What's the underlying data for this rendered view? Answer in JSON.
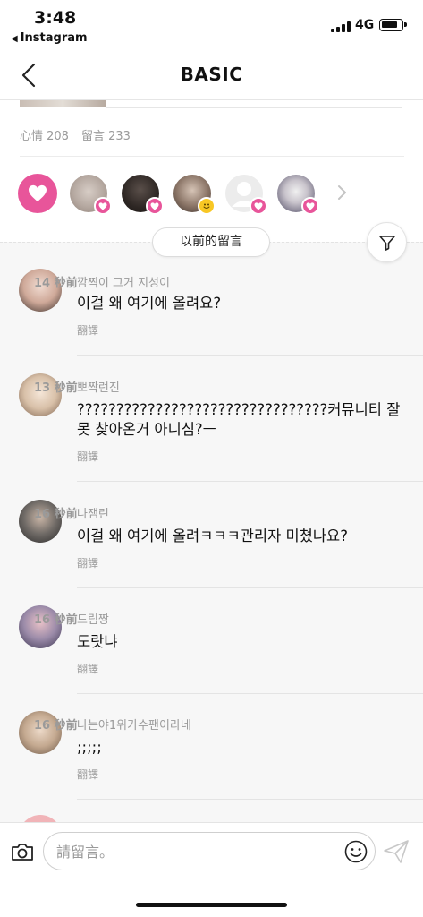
{
  "status_bar": {
    "time": "3:48",
    "back_app": "Instagram",
    "network": "4G"
  },
  "header": {
    "title": "BASIC"
  },
  "stats": {
    "likes": "心情 208",
    "comments": "留言 233"
  },
  "load_more": "以前的留言",
  "comments": [
    {
      "name": "깜찍이 그거 지성이",
      "time": "14 秒前",
      "text": "이걸 왜 여기에 올려요?",
      "translate": "翻譯",
      "avatar_color": "#d9cfcc"
    },
    {
      "name": "뽀짝런진",
      "time": "13 秒前",
      "text": "????????????????????????????????커뮤니티 잘 못 찾아온거 아니심?ㅡ",
      "translate": "翻譯",
      "avatar_color": "#e8d9c9"
    },
    {
      "name": "나잼린",
      "time": "16 秒前",
      "text": "이걸 왜 여기에 올려ㅋㅋㅋ관리자 미쳤나요?",
      "translate": "翻譯",
      "avatar_color": "#6f6a66"
    },
    {
      "name": "드림짱",
      "time": "16 秒前",
      "text": "도랏냐",
      "translate": "翻譯",
      "avatar_color": "#b7a8b8"
    },
    {
      "name": "나는야1위가수팬이라네",
      "time": "16 秒前",
      "text": ";;;;;",
      "translate": "翻譯",
      "avatar_color": "#cdb9a6"
    }
  ],
  "input": {
    "placeholder": "請留言。"
  },
  "colors": {
    "accent_pink": "#e8559a",
    "smile_yellow": "#f8c724"
  }
}
